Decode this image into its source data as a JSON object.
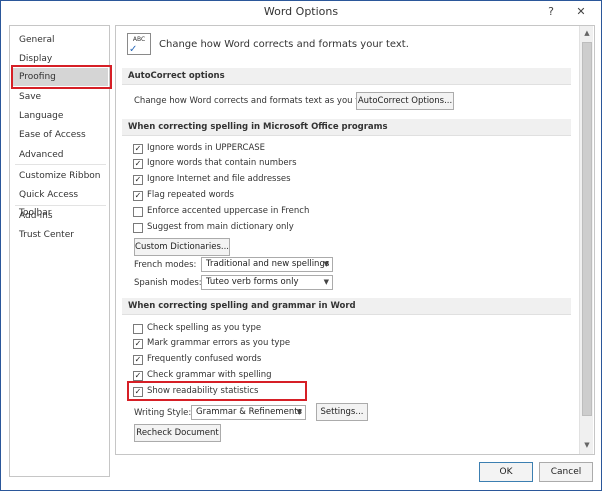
{
  "window": {
    "title": "Word Options",
    "help_label": "?",
    "close_label": "✕"
  },
  "sidebar": {
    "items": [
      {
        "label": "General"
      },
      {
        "label": "Display"
      },
      {
        "label": "Proofing",
        "selected": true
      },
      {
        "label": "Save"
      },
      {
        "label": "Language"
      },
      {
        "label": "Ease of Access"
      },
      {
        "label": "Advanced"
      },
      {
        "label": "Customize Ribbon"
      },
      {
        "label": "Quick Access Toolbar"
      },
      {
        "label": "Add-ins"
      },
      {
        "label": "Trust Center"
      }
    ]
  },
  "header": {
    "icon_text": "ABC",
    "text": "Change how Word corrects and formats your text."
  },
  "autocorrect": {
    "section_title": "AutoCorrect options",
    "description": "Change how Word corrects and formats text as you type:",
    "button_label": "AutoCorrect Options..."
  },
  "spelling_office": {
    "section_title": "When correcting spelling in Microsoft Office programs",
    "options": [
      {
        "label": "Ignore words in UPPERCASE",
        "checked": true
      },
      {
        "label": "Ignore words that contain numbers",
        "checked": true
      },
      {
        "label": "Ignore Internet and file addresses",
        "checked": true
      },
      {
        "label": "Flag repeated words",
        "checked": true
      },
      {
        "label": "Enforce accented uppercase in French",
        "checked": false
      },
      {
        "label": "Suggest from main dictionary only",
        "checked": false
      }
    ],
    "custom_dict_label": "Custom Dictionaries...",
    "french_modes_label": "French modes:",
    "french_modes_value": "Traditional and new spellings",
    "spanish_modes_label": "Spanish modes:",
    "spanish_modes_value": "Tuteo verb forms only"
  },
  "spelling_word": {
    "section_title": "When correcting spelling and grammar in Word",
    "options": [
      {
        "label": "Check spelling as you type",
        "checked": false
      },
      {
        "label": "Mark grammar errors as you type",
        "checked": true
      },
      {
        "label": "Frequently confused words",
        "checked": true
      },
      {
        "label": "Check grammar with spelling",
        "checked": true
      },
      {
        "label": "Show readability statistics",
        "checked": true
      }
    ],
    "writing_style_label": "Writing Style:",
    "writing_style_value": "Grammar & Refinements",
    "settings_label": "Settings...",
    "recheck_label": "Recheck Document"
  },
  "footer": {
    "ok_label": "OK",
    "cancel_label": "Cancel"
  },
  "check_mark": "✓",
  "dropdown_arrow": "▼",
  "scroll_up": "▲",
  "scroll_down": "▼"
}
